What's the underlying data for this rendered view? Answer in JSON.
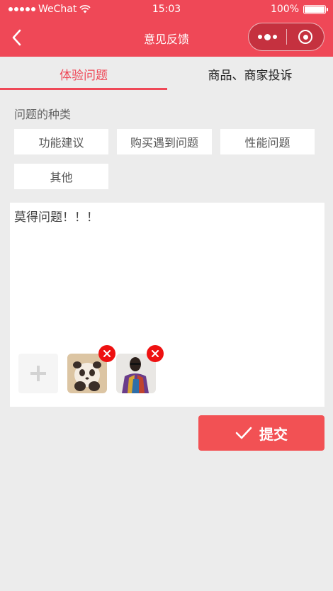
{
  "status_bar": {
    "carrier": "WeChat",
    "time": "15:03",
    "battery": "100%",
    "battery_level": 1.0
  },
  "nav": {
    "title": "意见反馈"
  },
  "tabs": [
    {
      "label": "体验问题",
      "active": true
    },
    {
      "label": "商品、商家投诉",
      "active": false
    }
  ],
  "category": {
    "label": "问题的种类",
    "options": [
      "功能建议",
      "购买遇到问题",
      "性能问题",
      "其他"
    ]
  },
  "feedback": {
    "text": "莫得问题！！！"
  },
  "submit": {
    "label": "提交"
  },
  "colors": {
    "brand": "#ef4857",
    "submit": "#f25154",
    "delete_badge": "#ee1111",
    "background": "#ececec"
  },
  "icons": {
    "back": "chevron-left-icon",
    "more": "more-dots-icon",
    "close": "circle-close-icon",
    "add": "plus-icon",
    "delete": "close-x-icon",
    "submit": "checkmark-icon"
  }
}
